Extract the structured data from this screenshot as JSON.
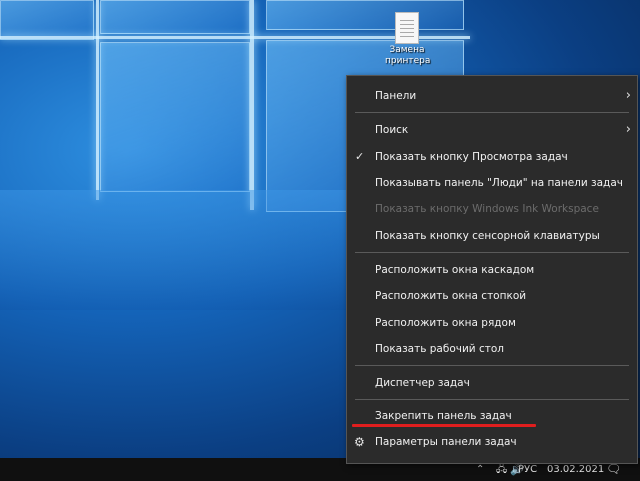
{
  "desktop": {
    "icon_label": "Замена принтера"
  },
  "context_menu": {
    "items": [
      {
        "label": "Панели",
        "submenu": true
      },
      {
        "label": "Поиск",
        "submenu": true
      },
      {
        "label": "Показать кнопку Просмотра задач",
        "checked": true
      },
      {
        "label": "Показывать панель \"Люди\" на панели задач"
      },
      {
        "label": "Показать кнопку Windows Ink Workspace",
        "disabled": true
      },
      {
        "label": "Показать кнопку сенсорной клавиатуры"
      },
      {
        "label": "Расположить окна каскадом"
      },
      {
        "label": "Расположить окна стопкой"
      },
      {
        "label": "Расположить окна рядом"
      },
      {
        "label": "Показать рабочий стол"
      },
      {
        "label": "Диспетчер задач"
      },
      {
        "label": "Закрепить панель задач",
        "highlighted": true
      },
      {
        "label": "Параметры панели задач",
        "icon": "gear-icon"
      }
    ]
  },
  "taskbar": {
    "tray_language": "РУС",
    "tray_date": "03.02.2021"
  },
  "colors": {
    "menu_bg": "#2b2b2b",
    "menu_text": "#f2f2f2",
    "disabled_text": "#6c6c6c",
    "highlight_underline": "#e01e1e",
    "taskbar_bg": "#101010"
  }
}
